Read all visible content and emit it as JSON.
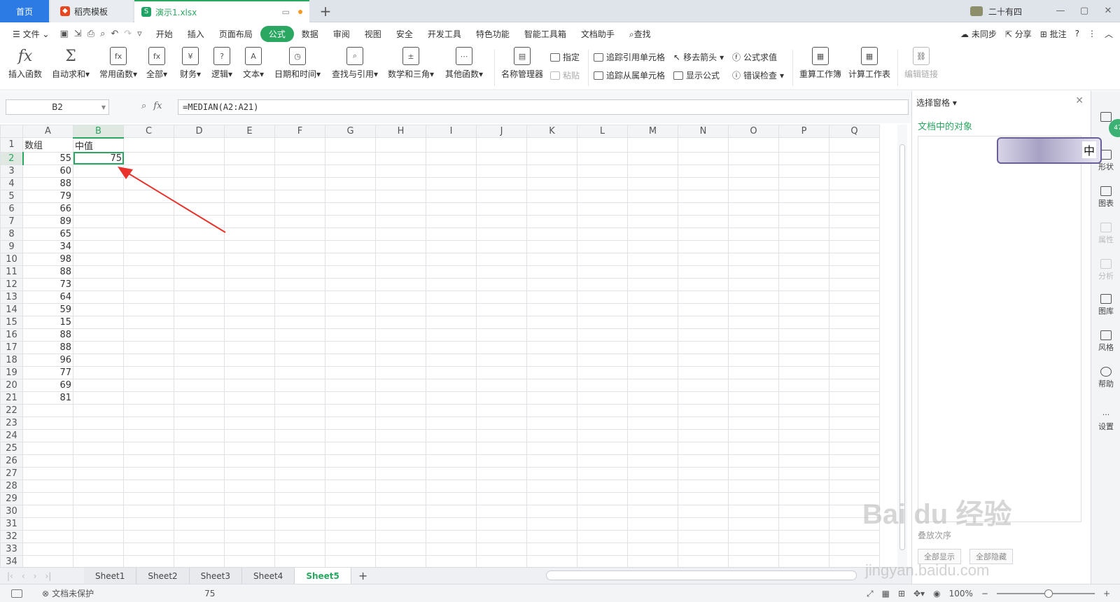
{
  "tabs": {
    "home": "首页",
    "template": "稻壳模板",
    "file": "演示1.xlsx",
    "add": "+"
  },
  "user": {
    "name": "二十有四"
  },
  "window_controls": [
    "—",
    "▢",
    "✕"
  ],
  "menu": {
    "file": "文件",
    "items": [
      "开始",
      "插入",
      "页面布局",
      "公式",
      "数据",
      "审阅",
      "视图",
      "安全",
      "开发工具",
      "特色功能",
      "智能工具箱",
      "文档助手"
    ],
    "active": "公式",
    "search": "查找",
    "right": {
      "sync": "未同步",
      "share": "分享",
      "comment": "批注",
      "help": "?"
    }
  },
  "ribbon": {
    "insert_fn": "插入函数",
    "autosum": "自动求和",
    "common": "常用函数",
    "all": "全部",
    "finance": "财务",
    "logic": "逻辑",
    "text": "文本",
    "datetime": "日期和时间",
    "lookup": "查找与引用",
    "math": "数学和三角",
    "other": "其他函数",
    "name_mgr": "名称管理器",
    "assign": "指定",
    "paste": "粘贴",
    "trace_prec": "追踪引用单元格",
    "trace_dep": "追踪从属单元格",
    "remove_arrows": "移去箭头",
    "show_formula": "显示公式",
    "eval_formula": "公式求值",
    "error_check": "错误检查",
    "recalc_book": "重算工作簿",
    "calc_sheet": "计算工作表",
    "edit_links": "编辑链接"
  },
  "formula_bar": {
    "name_box": "B2",
    "fx": "fx",
    "formula": "=MEDIAN(A2:A21)"
  },
  "grid": {
    "columns": [
      "A",
      "B",
      "C",
      "D",
      "E",
      "F",
      "G",
      "H",
      "I",
      "J",
      "K",
      "L",
      "M",
      "N",
      "O",
      "P",
      "Q"
    ],
    "row_count": 34,
    "header_a": "数组",
    "header_b": "中值",
    "values_a": [
      55,
      60,
      88,
      79,
      66,
      89,
      65,
      34,
      98,
      88,
      73,
      64,
      59,
      15,
      88,
      88,
      96,
      77,
      69,
      81
    ],
    "median_b2": 75,
    "active_cell": "B2"
  },
  "sheets": [
    "Sheet1",
    "Sheet2",
    "Sheet3",
    "Sheet4",
    "Sheet5"
  ],
  "active_sheet": "Sheet5",
  "status": {
    "protection": "文档未保护",
    "value": "75",
    "zoom": "100%"
  },
  "pane": {
    "title": "选择窗格",
    "subtitle": "文档中的对象",
    "footer": "叠放次序",
    "show_all": "全部显示",
    "hide_all": "全部隐藏"
  },
  "side_panel": [
    {
      "label": "形状",
      "icon": "shape-icon"
    },
    {
      "label": "图表",
      "icon": "chart-icon"
    },
    {
      "label": "属性",
      "icon": "property-icon"
    },
    {
      "label": "分析",
      "icon": "analysis-icon"
    },
    {
      "label": "图库",
      "icon": "gallery-icon"
    },
    {
      "label": "风格",
      "icon": "style-icon"
    },
    {
      "label": "帮助",
      "icon": "help-icon"
    },
    {
      "label": "设置",
      "icon": "settings-icon"
    }
  ],
  "sticker_ime": "中",
  "badge": "47",
  "watermark": {
    "main": "Bai du 经验",
    "sub": "jingyan.baidu.com"
  },
  "colors": {
    "accent": "#2aa760",
    "home_tab": "#2c7be5",
    "arrow": "#e8322b"
  }
}
